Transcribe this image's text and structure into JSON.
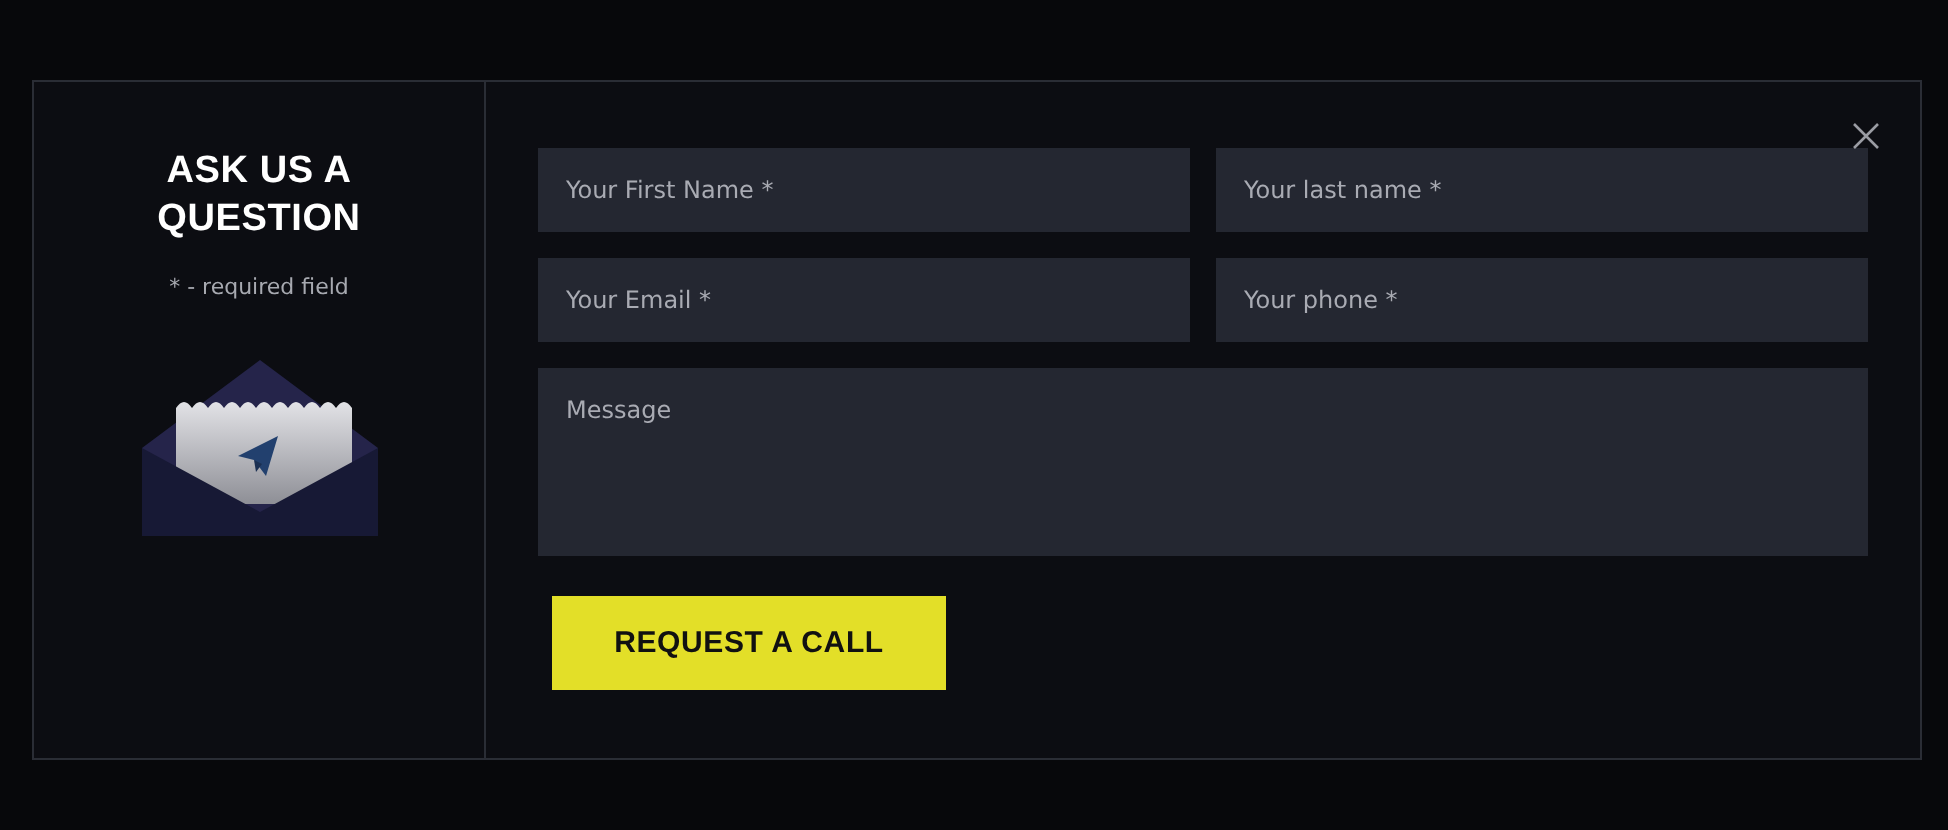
{
  "title": "ASK US A QUESTION",
  "note": "* - required field",
  "fields": [
    {
      "placeholder": "Your First Name *",
      "kind": "text"
    },
    {
      "placeholder": "Your last name *",
      "kind": "text"
    },
    {
      "placeholder": "Your Email *",
      "kind": "text"
    },
    {
      "placeholder": "Your phone *",
      "kind": "text"
    },
    {
      "placeholder": "Message",
      "kind": "textarea"
    }
  ],
  "submit": "REQUEST A CALL"
}
